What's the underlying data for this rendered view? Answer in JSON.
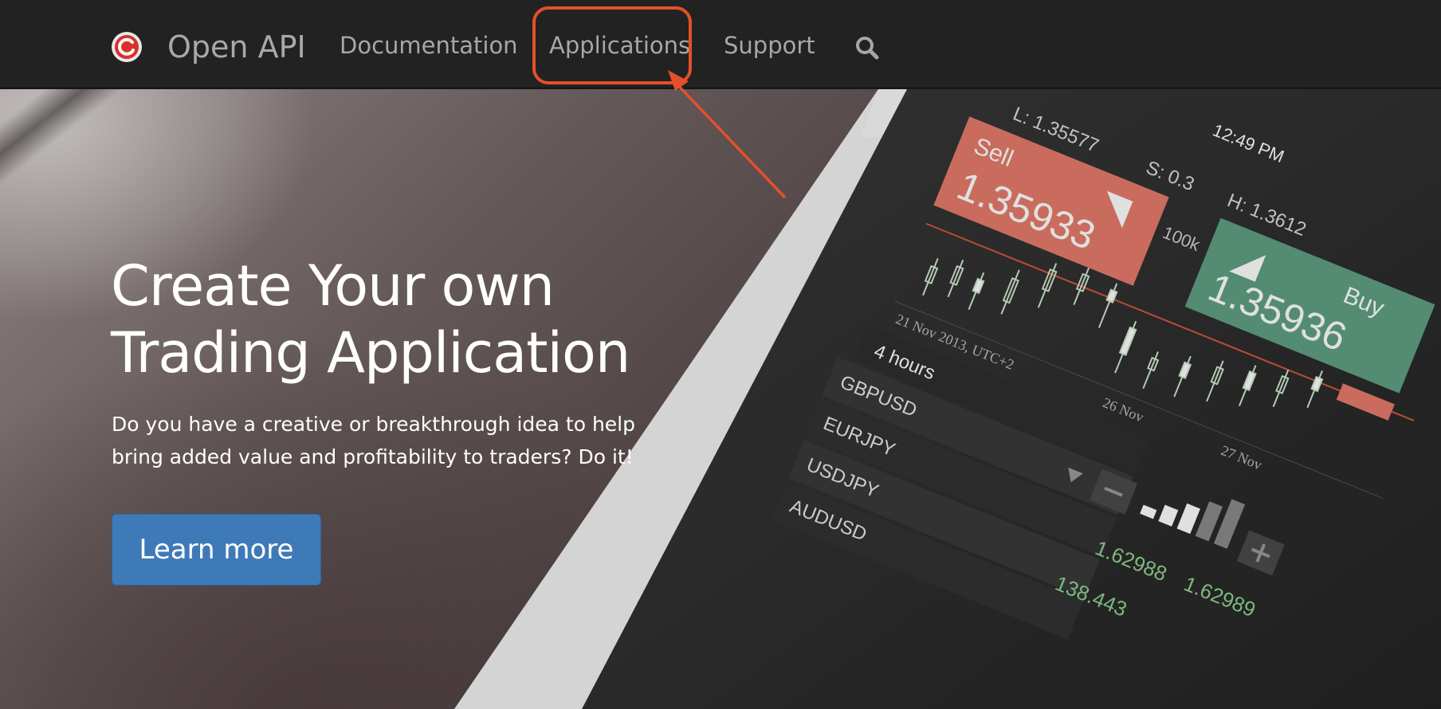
{
  "nav": {
    "brand": "Open API",
    "links": [
      "Documentation",
      "Applications",
      "Support"
    ],
    "search_icon": "search-icon",
    "highlighted": "Applications",
    "annotation_color": "#e4502b"
  },
  "hero": {
    "title_line1": "Create Your own",
    "title_line2": "Trading Application",
    "subtitle_line1": "Do you have a creative or breakthrough idea to help",
    "subtitle_line2": "bring added value and profitability to traders? Do it!",
    "cta": "Learn more",
    "cta_color": "#3f7ab8"
  },
  "phone_screen": {
    "time": "12:49 PM",
    "low": "L: 1.35577",
    "spread": "S: 0.3",
    "high": "H: 1.3612",
    "sell_label": "Sell",
    "sell_price": "1.35933",
    "sell_color": "#e57c6b",
    "buy_label": "Buy",
    "buy_price": "1.35936",
    "buy_color": "#5fa082",
    "volume": "100k",
    "timeframe": "4 hours",
    "date_label": "21 Nov 2013, UTC+2",
    "date_tick_1": "26 Nov",
    "date_tick_2": "27 Nov",
    "symbols": [
      "GBPUSD",
      "EURJPY",
      "USDJPY",
      "AUDUSD"
    ],
    "quote_bid": "1.62988",
    "quote_ask": "1.62989",
    "quote_other": "138.443"
  }
}
